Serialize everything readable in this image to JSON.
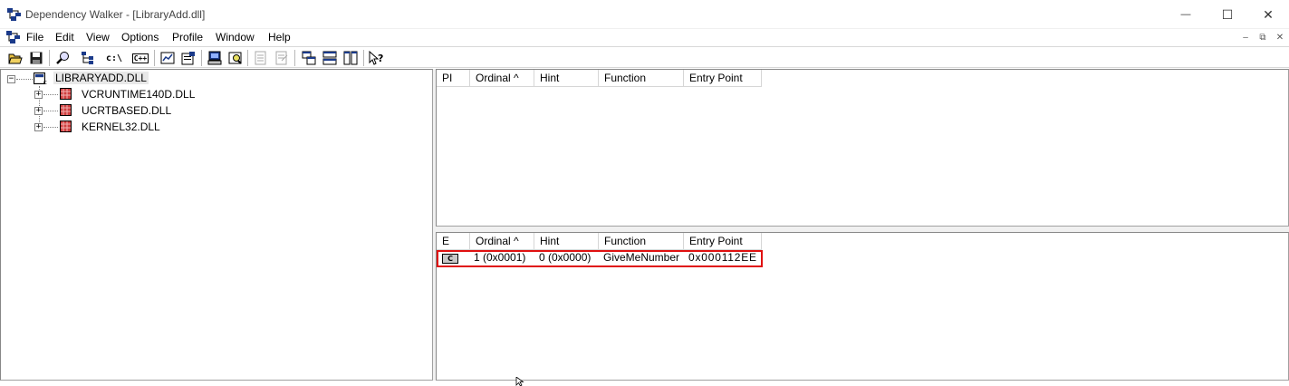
{
  "window": {
    "title": "Dependency Walker - [LibraryAdd.dll]",
    "minimize_glyph": "—",
    "maximize_glyph": "☐",
    "close_glyph": "✕"
  },
  "menu": {
    "items": [
      "File",
      "Edit",
      "View",
      "Options",
      "Profile",
      "Window",
      "Help"
    ],
    "mdi_min": "–",
    "mdi_restore": "⧉",
    "mdi_close": "✕"
  },
  "toolbar": {
    "buttons": [
      {
        "name": "open-icon"
      },
      {
        "name": "save-icon"
      },
      {
        "name": "find-icon"
      },
      {
        "name": "module-tree-icon"
      },
      {
        "name": "full-paths-icon",
        "text": "c:\\"
      },
      {
        "name": "undecorate-cpp-icon",
        "text": "C++"
      },
      {
        "name": "auto-expand-icon"
      },
      {
        "name": "properties-icon"
      },
      {
        "name": "system-info-icon"
      },
      {
        "name": "view-module-icon"
      },
      {
        "name": "prev-import-icon"
      },
      {
        "name": "next-import-icon"
      },
      {
        "name": "cascade-icon"
      },
      {
        "name": "tile-horizontal-icon"
      },
      {
        "name": "tile-vertical-icon"
      },
      {
        "name": "help-icon"
      }
    ]
  },
  "tree": {
    "root": {
      "label": "LIBRARYADD.DLL",
      "expander": "−"
    },
    "children": [
      {
        "label": "VCRUNTIME140D.DLL",
        "expander": "+"
      },
      {
        "label": "UCRTBASED.DLL",
        "expander": "+"
      },
      {
        "label": "KERNEL32.DLL",
        "expander": "+"
      }
    ]
  },
  "imports_list": {
    "columns": [
      "PI",
      "Ordinal ^",
      "Hint",
      "Function",
      "Entry Point"
    ],
    "rows": []
  },
  "exports_list": {
    "columns": [
      "E",
      "Ordinal ^",
      "Hint",
      "Function",
      "Entry Point"
    ],
    "rows": [
      {
        "type_icon": "C",
        "ordinal": "1 (0x0001)",
        "hint": "0 (0x0000)",
        "function": "GiveMeNumber",
        "entry_point": "0x000112EE"
      }
    ]
  },
  "colors": {
    "highlight": "#e01010"
  }
}
